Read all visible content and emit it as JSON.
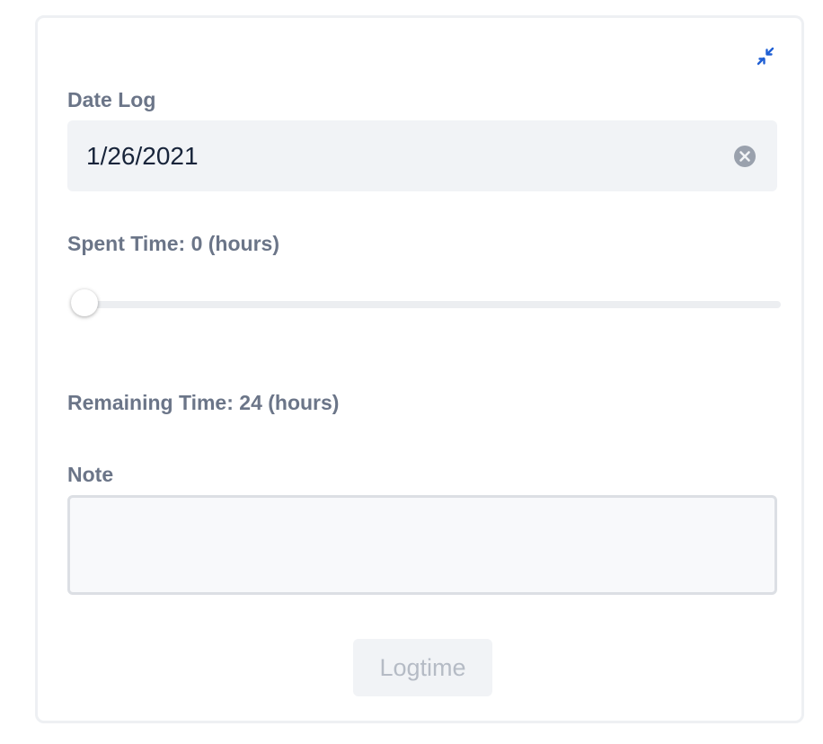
{
  "form": {
    "collapse_icon": "collapse-arrows-icon",
    "date_log": {
      "label": "Date Log",
      "value": "1/26/2021",
      "clear_icon": "clear-circle-icon"
    },
    "spent_time": {
      "label": "Spent Time: 0 (hours)",
      "slider_value": 0,
      "slider_min": 0,
      "slider_max": 24
    },
    "remaining_time": {
      "label": "Remaining Time: 24 (hours)"
    },
    "note": {
      "label": "Note",
      "value": ""
    },
    "submit": {
      "label": "Logtime",
      "disabled": true
    }
  },
  "colors": {
    "accent": "#1f5fd4",
    "label_text": "#6b7588",
    "input_bg": "#f1f3f6",
    "disabled_text": "#b5bbc5"
  }
}
